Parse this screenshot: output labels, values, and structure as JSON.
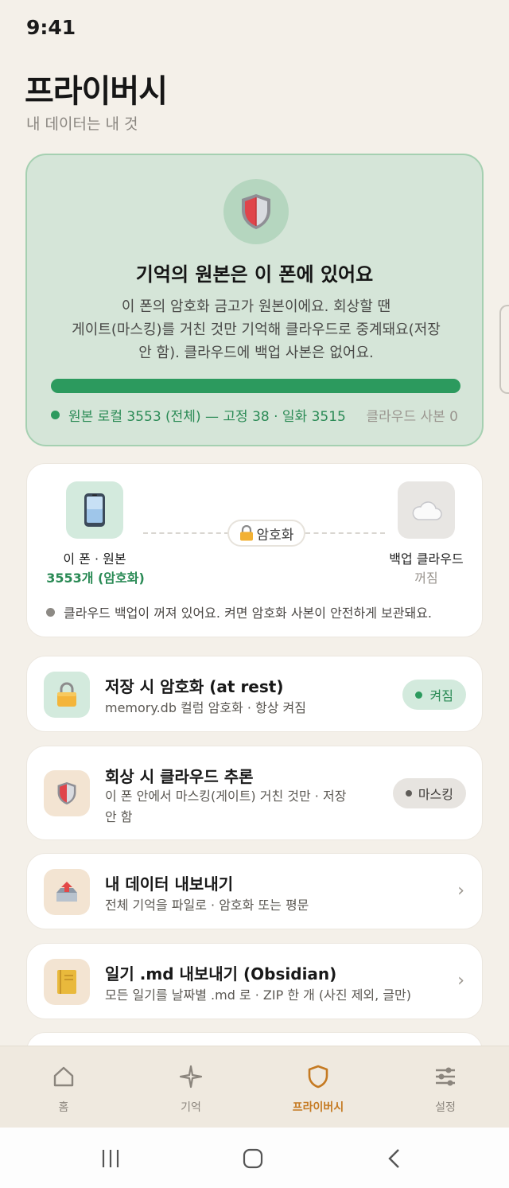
{
  "status_bar": {
    "time": "9:41"
  },
  "header": {
    "title": "프라이버시",
    "subtitle": "내 데이터는 내 것"
  },
  "hero": {
    "icon": "shield-icon",
    "title": "기억의 원본은 이 폰에 있어요",
    "body_lines": [
      "이 폰의 암호화 금고가 원본이에요. 회상할 땐",
      "게이트(마스킹)를 거친 것만 기억해 클라우드로 중계돼요(저장",
      "안 함). 클라우드에 백업 사본은 없어요."
    ],
    "local_ratio": 1.0,
    "stats": "원본 로컬 3553 (전체) — 고정 38 · 일화 3515",
    "cloud_copies": "클라우드 사본 0"
  },
  "sync": {
    "device_icon": "phone-icon",
    "device_label": "이 폰 · 원본",
    "device_count": "3553개 (암호화)",
    "link_label": "암호화",
    "cloud_icon": "cloud-icon",
    "cloud_label": "백업 클라우드",
    "cloud_status": "꺼짐",
    "note": "클라우드 백업이 꺼져 있어요. 켜면 암호화 사본이 안전하게 보관돼요."
  },
  "rows": [
    {
      "icon": "lock-icon",
      "title": "저장 시 암호화 (at rest)",
      "subtitle": "memory.db 컬럼 암호화 · 항상 켜짐",
      "badge": "켜짐"
    },
    {
      "icon": "shield-icon",
      "title": "회상 시 클라우드 추론",
      "subtitle_lines": [
        "이 폰 안에서 마스킹(게이트) 거친 것만 · 저장",
        "안 함"
      ],
      "badge": "마스킹"
    },
    {
      "icon": "export-tray-icon",
      "title": "내 데이터 내보내기",
      "subtitle": "전체 기억을 파일로 · 암호화 또는 평문",
      "chevron": "›"
    },
    {
      "icon": "notebook-icon",
      "title": "일기 .md 내보내기 (Obsidian)",
      "subtitle": "모든 일기를 날짜별 .md 로 · ZIP 한 개 (사진 제외, 글만)",
      "chevron": "›"
    }
  ],
  "bottom_nav": {
    "items": [
      {
        "label": "홈",
        "icon": "home-icon"
      },
      {
        "label": "기억",
        "icon": "sparkle-icon"
      },
      {
        "label": "프라이버시",
        "icon": "shield-outline-icon",
        "active": true
      },
      {
        "label": "설정",
        "icon": "sliders-icon"
      }
    ]
  },
  "colors": {
    "accent": "#c57a22",
    "green": "#2c9a5e",
    "hero_bg": "#d5e5d8",
    "page_bg": "#f4f0e9"
  }
}
